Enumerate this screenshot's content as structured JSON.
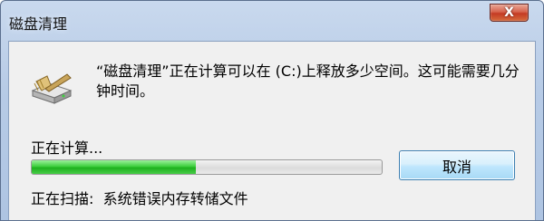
{
  "window": {
    "title": "磁盘清理",
    "close_glyph": "X"
  },
  "dialog": {
    "icon": "disk-cleanup-icon",
    "message": "“磁盘清理”正在计算可以在 (C:)上释放多少空间。这可能需要几分钟时间。",
    "status_label": "正在计算...",
    "progress": 0.47,
    "scan_label": "正在扫描:  系统错误内存转储文件",
    "cancel_label": "取消"
  },
  "colors": {
    "progress_green": "#2fbf2f",
    "button_border": "#3c7fb1",
    "close_red": "#c43b23"
  }
}
